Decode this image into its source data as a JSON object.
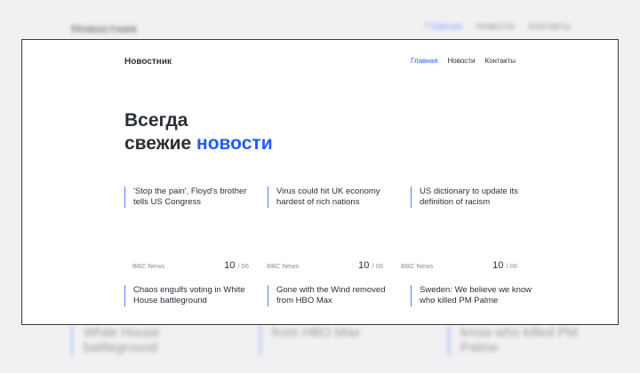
{
  "site": {
    "brand": "Новостник"
  },
  "nav": [
    {
      "label": "Главная",
      "active": true
    },
    {
      "label": "Новости",
      "active": false
    },
    {
      "label": "Контакты",
      "active": false
    }
  ],
  "hero": {
    "line1": "Всегда",
    "line2_plain": "свежие ",
    "line2_accent": "новости"
  },
  "top_articles": [
    {
      "title": "'Stop the pain', Floyd's brother tells US Congress"
    },
    {
      "title": "Virus could hit UK economy hardest of rich nations"
    },
    {
      "title": "US dictionary to update its definition of racism"
    }
  ],
  "meta": [
    {
      "source": "BBC News",
      "current": "10",
      "total": "/ 06"
    },
    {
      "source": "BBC News",
      "current": "10",
      "total": "/ 06"
    },
    {
      "source": "BBC News",
      "current": "10",
      "total": "/ 06"
    }
  ],
  "bottom_articles": [
    {
      "title": "Chaos engulfs voting in White House battleground"
    },
    {
      "title": "Gone with the Wind removed from HBO Max"
    },
    {
      "title": "Sweden: We believe we know who killed PM Palme"
    }
  ],
  "background": {
    "brand": "Новостник",
    "nav": [
      "Главная",
      "Новости",
      "Контакты"
    ],
    "bottom": [
      "White House battleground",
      "from HBO Max",
      "know who killed PM Palme"
    ]
  },
  "colors": {
    "accent": "#1f5bff",
    "text": "#2c3038",
    "muted": "#8a8f98",
    "background": "#f1f1f3"
  }
}
